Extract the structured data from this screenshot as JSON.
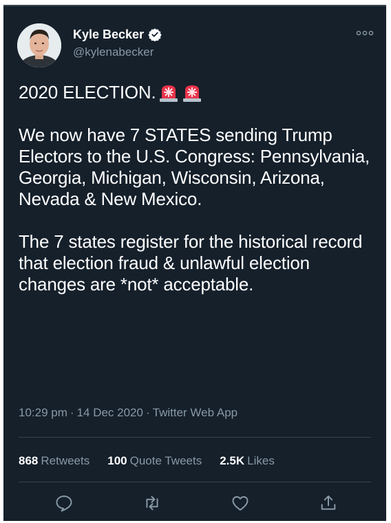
{
  "author": {
    "name": "Kyle Becker",
    "handle": "@kylenabecker",
    "verified": true
  },
  "tweet": {
    "line1": "2020 ELECTION.",
    "emoji": [
      "siren-emoji",
      "siren-emoji"
    ],
    "para2": "We now have 7 STATES sending Trump Electors to the U.S. Congress: Pennsylvania, Georgia, Michigan, Wisconsin, Arizona, Nevada & New Mexico.",
    "para3": "The 7 states register for the historical record that election fraud & unlawful election changes are *not* acceptable."
  },
  "meta": {
    "time": "10:29 pm",
    "date": "14 Dec 2020",
    "source": "Twitter Web App",
    "separator": "·"
  },
  "stats": {
    "retweets_count": "868",
    "retweets_label": "Retweets",
    "quote_count": "100",
    "quote_label": "Quote Tweets",
    "likes_count": "2.5K",
    "likes_label": "Likes"
  },
  "colors": {
    "background": "#15202b",
    "text": "#ffffff",
    "secondary": "#8899a6",
    "divider": "#38444d",
    "verified": "#ffffff"
  },
  "icons": [
    "reply-icon",
    "retweet-icon",
    "like-icon",
    "share-icon",
    "more-icon",
    "verified-badge-icon"
  ]
}
